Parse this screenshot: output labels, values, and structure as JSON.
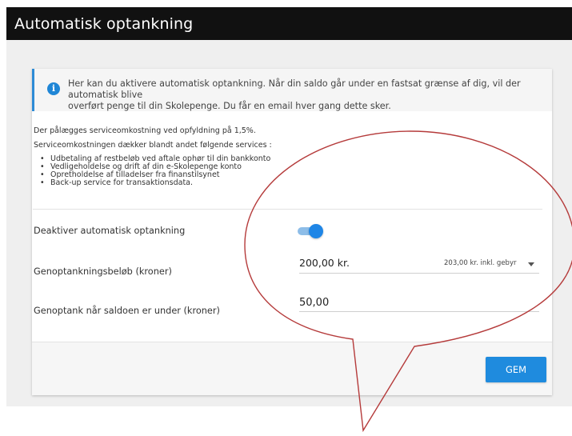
{
  "window": {
    "title": "Automatisk optankning"
  },
  "info": {
    "icon": "info-icon",
    "line1": "Her kan du aktivere automatisk optankning. Når din saldo går under en fastsat grænse af dig, vil der automatisk blive",
    "line2": "overført penge til din Skolepenge. Du får en email hver gang dette sker."
  },
  "fees": {
    "line1": "Der pålægges serviceomkostning ved opfyldning på 1,5%.",
    "line2": "Serviceomkostningen dækker blandt andet følgende services :",
    "services": [
      "Udbetaling af restbeløb ved aftale ophør til din bankkonto",
      "Vedligeholdelse og drift af din e-Skolepenge konto",
      "Opretholdelse af tilladelser fra finanstilsynet",
      "Back-up service for transaktionsdata."
    ]
  },
  "form": {
    "toggle_label": "Deaktiver automatisk optankning",
    "toggle_on": true,
    "amount_label": "Genoptankningsbeløb (kroner)",
    "amount_value": "200,00 kr.",
    "amount_note": "203,00 kr. inkl. gebyr",
    "threshold_label": "Genoptank når saldoen er under (kroner)",
    "threshold_value": "50,00"
  },
  "footer": {
    "save_label": "GEM"
  },
  "colors": {
    "accent": "#1f8bde",
    "titlebar": "#111111",
    "callout": "#b53b3b"
  }
}
